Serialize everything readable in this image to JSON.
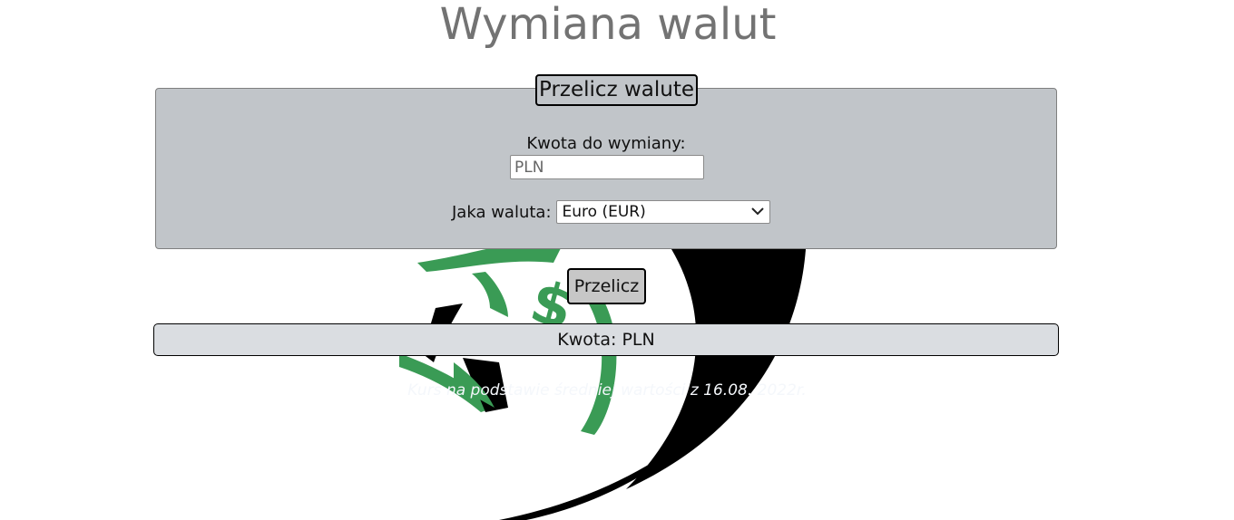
{
  "page": {
    "title": "Wymiana walut"
  },
  "form": {
    "legend": "Przelicz walute",
    "amount_label": "Kwota do wymiany:",
    "amount_placeholder": "PLN",
    "amount_value": "",
    "currency_label": "Jaka waluta:",
    "currency_selected": "Euro (EUR)",
    "convert_label": "Przelicz"
  },
  "result": {
    "text": "Kwota: PLN"
  },
  "footnote": {
    "text": "Kurs na podstawie średniej wartości z 16.08. 2022r."
  },
  "colors": {
    "title": "#737373",
    "panel_bg": "#c1c5c9",
    "result_bg": "#dadde1",
    "logo_green": "#3a9b55",
    "logo_black": "#000000"
  },
  "icons": {
    "select_arrow": "chevron-down-icon",
    "background": "money-logo"
  }
}
